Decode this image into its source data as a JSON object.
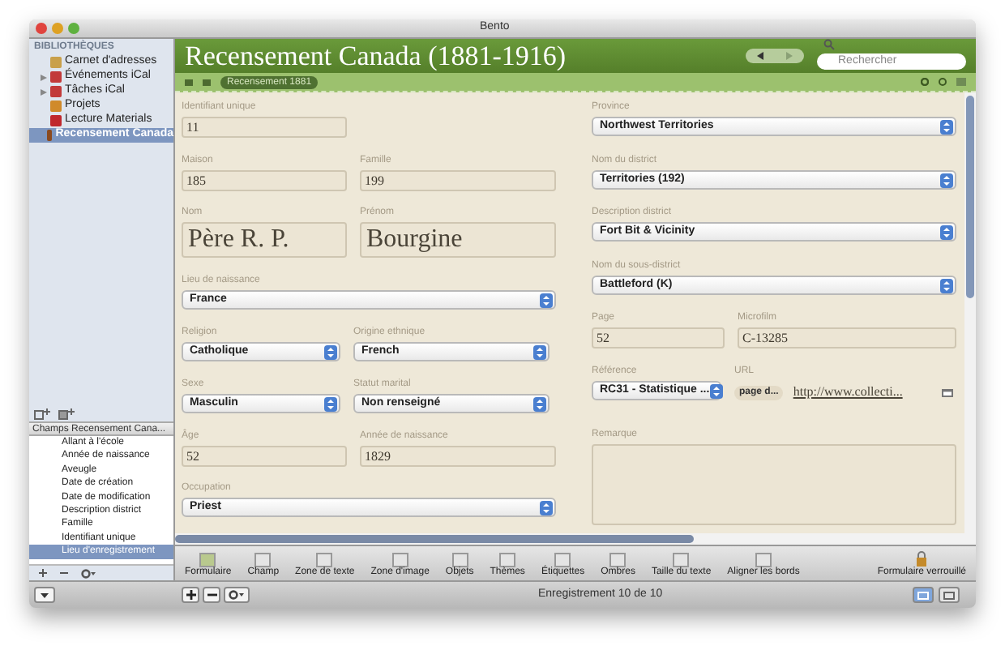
{
  "window": {
    "title": "Bento"
  },
  "sidebar": {
    "header": "BIBLIOTHÈQUES",
    "items": [
      {
        "label": "Carnet d'adresses",
        "selected": false,
        "color": "#c9a04a"
      },
      {
        "label": "Événements iCal",
        "selected": false,
        "expanded": false,
        "color": "#c23a3a"
      },
      {
        "label": "Tâches iCal",
        "selected": false,
        "expanded": false,
        "color": "#c23a3a"
      },
      {
        "label": "Projets",
        "selected": false,
        "color": "#d08a2a"
      },
      {
        "label": "Lecture Materials",
        "selected": false,
        "color": "#c0282d"
      },
      {
        "label": "Recensement Canada",
        "selected": true,
        "color": "#8a4a20"
      }
    ]
  },
  "fields_panel": {
    "header": "Champs Recensement Cana...",
    "items": [
      {
        "label": "Allant à l'école",
        "selected": false
      },
      {
        "label": "Année de naissance",
        "selected": false
      },
      {
        "label": "Aveugle",
        "selected": false
      },
      {
        "label": "Date de création",
        "selected": false
      },
      {
        "label": "Date de modification",
        "selected": false
      },
      {
        "label": "Description district",
        "selected": false
      },
      {
        "label": "Famille",
        "selected": false
      },
      {
        "label": "Identifiant unique",
        "selected": false
      },
      {
        "label": "Lieu d'enregistrement",
        "selected": true
      }
    ]
  },
  "header": {
    "title": "Recensement Canada (1881-1916)",
    "search": {
      "placeholder": "Rechercher"
    },
    "form_tab": "Recensement 1881"
  },
  "form": {
    "left": [
      {
        "fields": [
          {
            "label": "Identifiant unique",
            "value": "11",
            "kind": "text"
          }
        ]
      },
      {
        "fields": [
          {
            "label": "Maison",
            "value": "185",
            "kind": "text"
          },
          {
            "label": "Famille",
            "value": "199",
            "kind": "text"
          }
        ]
      },
      {
        "fields": [
          {
            "label": "Nom",
            "value": "Père R. P.",
            "kind": "large"
          },
          {
            "label": "Prénom",
            "value": "Bourgine",
            "kind": "large"
          }
        ]
      },
      {
        "fields": [
          {
            "label": "Lieu de naissance",
            "value": "France",
            "kind": "select"
          }
        ]
      },
      {
        "fields": [
          {
            "label": "Religion",
            "value": "Catholique",
            "kind": "select"
          },
          {
            "label": "Origine ethnique",
            "value": "French",
            "kind": "select"
          }
        ]
      },
      {
        "fields": [
          {
            "label": "Sexe",
            "value": "Masculin",
            "kind": "select"
          },
          {
            "label": "Statut marital",
            "value": "Non renseigné",
            "kind": "select"
          }
        ]
      },
      {
        "fields": [
          {
            "label": "Âge",
            "value": "52",
            "kind": "text"
          },
          {
            "label": "Année de naissance",
            "value": "1829",
            "kind": "text"
          }
        ]
      },
      {
        "fields": [
          {
            "label": "Occupation",
            "value": "Priest",
            "kind": "select"
          }
        ]
      }
    ],
    "right": [
      {
        "fields": [
          {
            "label": "Province",
            "value": "Northwest Territories",
            "kind": "select"
          }
        ]
      },
      {
        "fields": [
          {
            "label": "Nom du district",
            "value": "Territories (192)",
            "kind": "select"
          }
        ]
      },
      {
        "fields": [
          {
            "label": "Description district",
            "value": "Fort Bit & Vicinity",
            "kind": "select"
          }
        ]
      },
      {
        "fields": [
          {
            "label": "Nom du sous-district",
            "value": "Battleford (K)",
            "kind": "select"
          }
        ]
      },
      {
        "fields": [
          {
            "label": "Page",
            "value": "52",
            "kind": "text"
          },
          {
            "label": "Microfilm",
            "value": "C-13285",
            "kind": "text"
          }
        ]
      },
      {
        "fields": [
          {
            "label": "Référence",
            "value": "RC31 - Statistique ...",
            "kind": "select"
          },
          {
            "label": "URL",
            "value": "http://www.collecti...",
            "popup": "page d...",
            "kind": "url"
          }
        ]
      },
      {
        "fields": [
          {
            "label": "Remarque",
            "kind": "textarea"
          }
        ]
      }
    ]
  },
  "toolbar": [
    {
      "label": "Formulaire"
    },
    {
      "label": "Champ"
    },
    {
      "label": "Zone de texte"
    },
    {
      "label": "Zone d'image"
    },
    {
      "label": "Objets"
    },
    {
      "label": "Thèmes"
    },
    {
      "label": "Étiquettes"
    },
    {
      "label": "Ombres"
    },
    {
      "label": "Taille du texte"
    },
    {
      "label": "Aligner les bords"
    }
  ],
  "lock": {
    "label": "Formulaire verrouillé"
  },
  "status_bar": {
    "text": "Enregistrement 10 de 10",
    "views": [
      {
        "selected": true
      },
      {
        "selected": false
      }
    ]
  }
}
